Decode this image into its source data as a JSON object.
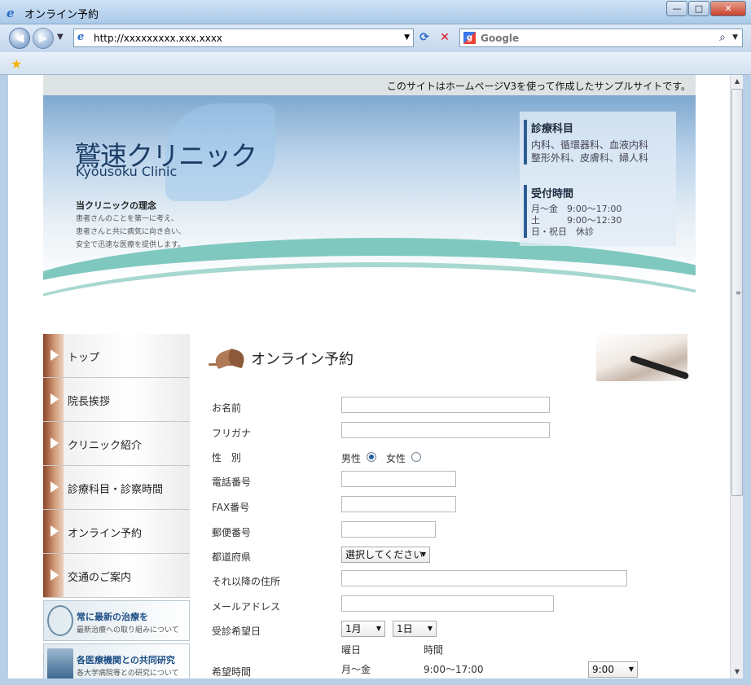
{
  "window": {
    "title": "オンライン予約",
    "min": "—",
    "max": "□",
    "close": "✕"
  },
  "nav": {
    "url": "http://xxxxxxxxx.xxx.xxxx",
    "search_placeholder": "Google",
    "search_logo": "g"
  },
  "site": {
    "notice": "このサイトはホームページV3を使って作成したサンプルサイトです。",
    "logo_jp": "鷲速クリニック",
    "logo_en": "Kyousoku Clinic",
    "philosophy_title": "当クリニックの理念",
    "philosophy": [
      "患者さんのことを第一に考え、",
      "患者さんと共に病気に向き合い、",
      "安全で迅速な医療を提供します。"
    ],
    "departments_title": "診療科目",
    "departments": [
      "内科、循環器科、血液内科",
      "整形外科、皮膚科、婦人科"
    ],
    "hours_title": "受付時間",
    "hours": [
      "月～金　9:00～17:00",
      "土　　　9:00～12:30",
      "日・祝日　休診"
    ]
  },
  "sidebar": {
    "items": [
      {
        "label": "トップ"
      },
      {
        "label": "院長挨拶"
      },
      {
        "label": "クリニック紹介"
      },
      {
        "label": "診療科目・診察時間"
      },
      {
        "label": "オンライン予約"
      },
      {
        "label": "交通のご案内"
      }
    ],
    "banners": [
      {
        "title": "常に最新の治療を",
        "sub": "最新治療への取り組みについて"
      },
      {
        "title": "各医療機関との共同研究",
        "sub": "各大学病院等との研究について"
      }
    ]
  },
  "page": {
    "heading": "オンライン予約"
  },
  "form": {
    "name_label": "お名前",
    "furigana_label": "フリガナ",
    "gender_label": "性　別",
    "gender_male": "男性",
    "gender_female": "女性",
    "phone_label": "電話番号",
    "fax_label": "FAX番号",
    "zip_label": "郵便番号",
    "pref_label": "都道府県",
    "pref_value": "選択してください",
    "address_label": "それ以降の住所",
    "email_label": "メールアドレス",
    "date_label": "受診希望日",
    "month_value": "1月",
    "day_value": "1日",
    "weekday_header": "曜日",
    "time_header": "時間",
    "time_label": "希望時間",
    "time_weekday": "月～金",
    "time_range": "9:00～17:00",
    "time_value": "9:00"
  }
}
